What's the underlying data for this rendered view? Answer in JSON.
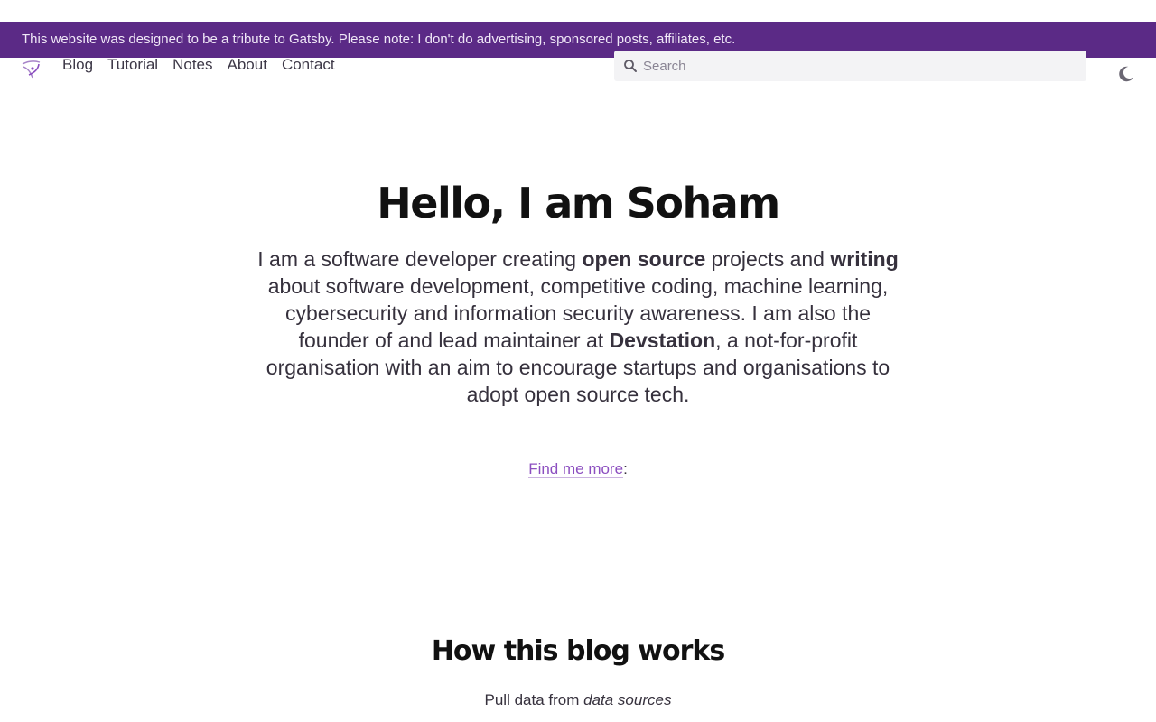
{
  "banner": {
    "text": "This website was designed to be a tribute to Gatsby. Please note: I don't do advertising, sponsored posts, affiliates, etc."
  },
  "nav": {
    "links": [
      {
        "label": "Blog"
      },
      {
        "label": "Tutorial"
      },
      {
        "label": "Notes"
      },
      {
        "label": "About"
      },
      {
        "label": "Contact"
      }
    ]
  },
  "search": {
    "placeholder": "Search",
    "value": ""
  },
  "hero": {
    "title": "Hello, I am Soham",
    "intro_1": "I am a software developer creating ",
    "intro_bold_1": "open source",
    "intro_2": " projects and ",
    "intro_bold_2": "writing",
    "intro_3": " about software development, competitive coding, machine learning, cybersecurity and information security awareness. I am also the founder of and lead maintainer at ",
    "intro_bold_3": "Devstation",
    "intro_4": ", a not-for-profit organisation with an aim to encourage startups and organisations to adopt open source tech."
  },
  "find_more": {
    "link": "Find me more",
    "suffix": ":"
  },
  "how_it_works": {
    "title": "How this blog works",
    "line_prefix": "Pull data from ",
    "line_emphasis": "data sources"
  },
  "colors": {
    "banner_bg": "#5b2a86",
    "accent": "#8c4fc0"
  },
  "icons": {
    "logo": "gatsby-tribute-logo-icon",
    "search": "search-icon",
    "theme": "moon-icon"
  }
}
